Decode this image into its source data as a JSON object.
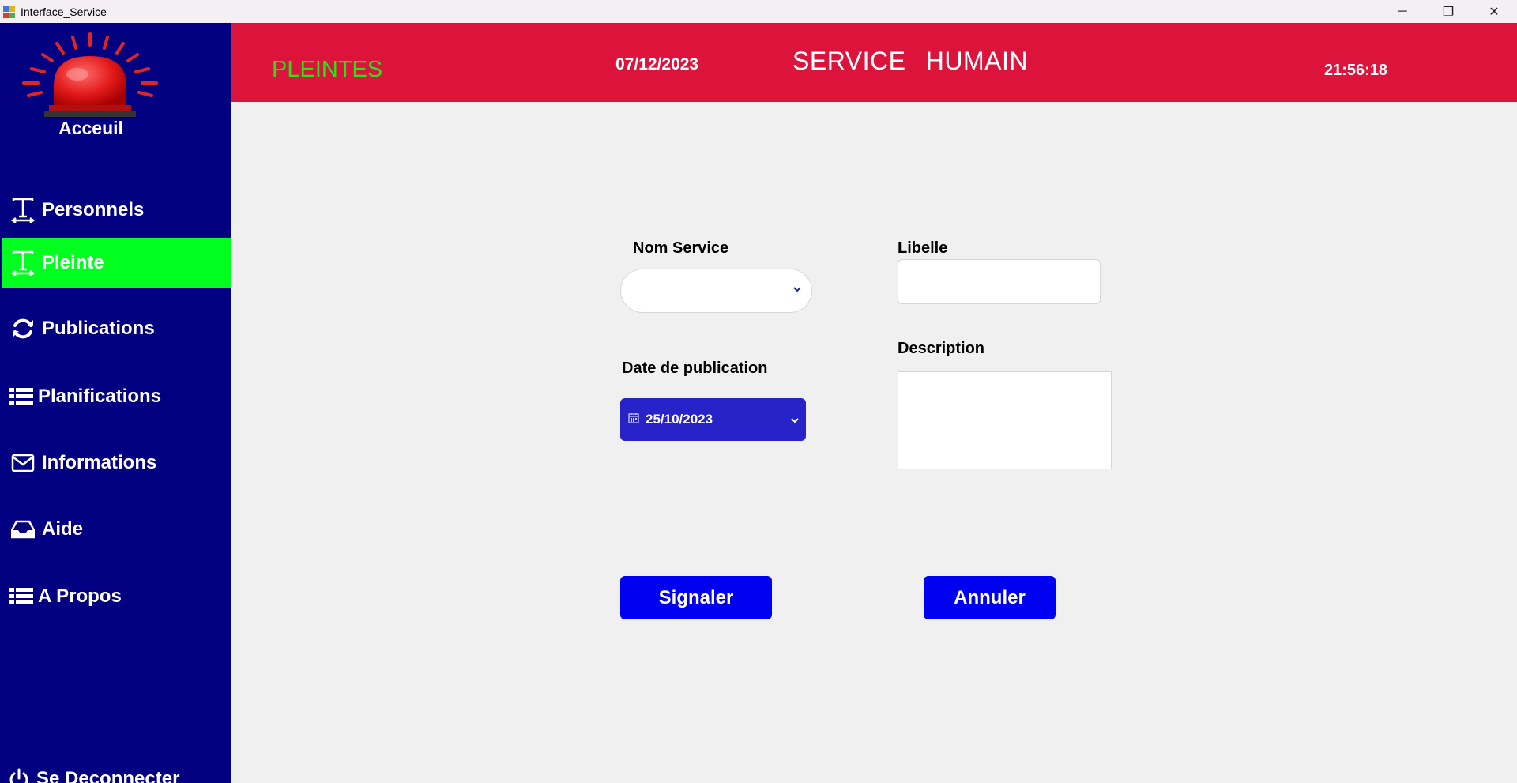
{
  "window": {
    "title": "Interface_Service",
    "controls": [
      "─",
      "❐",
      "✕"
    ]
  },
  "sidebar": {
    "home_label": "Acceuil",
    "items": [
      {
        "label": "Personnels",
        "icon": "text-resize-icon"
      },
      {
        "label": "Pleinte",
        "icon": "text-resize-icon",
        "active": true
      },
      {
        "label": "Publications",
        "icon": "refresh-icon"
      },
      {
        "label": "Planifications",
        "icon": "list-icon"
      },
      {
        "label": "Informations",
        "icon": "envelope-icon"
      },
      {
        "label": "Aide",
        "icon": "inbox-icon"
      },
      {
        "label": "A Propos",
        "icon": "list-icon"
      }
    ],
    "logout_label": "Se Deconnecter",
    "active_color": "#00ff1e",
    "background": "#020080"
  },
  "header": {
    "section_title": "PLEINTES",
    "date": "07/12/2023",
    "service_title": "SERVICE HUMAIN",
    "clock": "21:56:18",
    "background": "#dc143c"
  },
  "form": {
    "nom_service_label": "Nom Service",
    "nom_service_value": "",
    "libelle_label": "Libelle",
    "libelle_value": "",
    "date_label": "Date de publication",
    "date_value": "25/10/2023",
    "description_label": "Description",
    "description_value": "",
    "submit_label": "Signaler",
    "cancel_label": "Annuler"
  }
}
